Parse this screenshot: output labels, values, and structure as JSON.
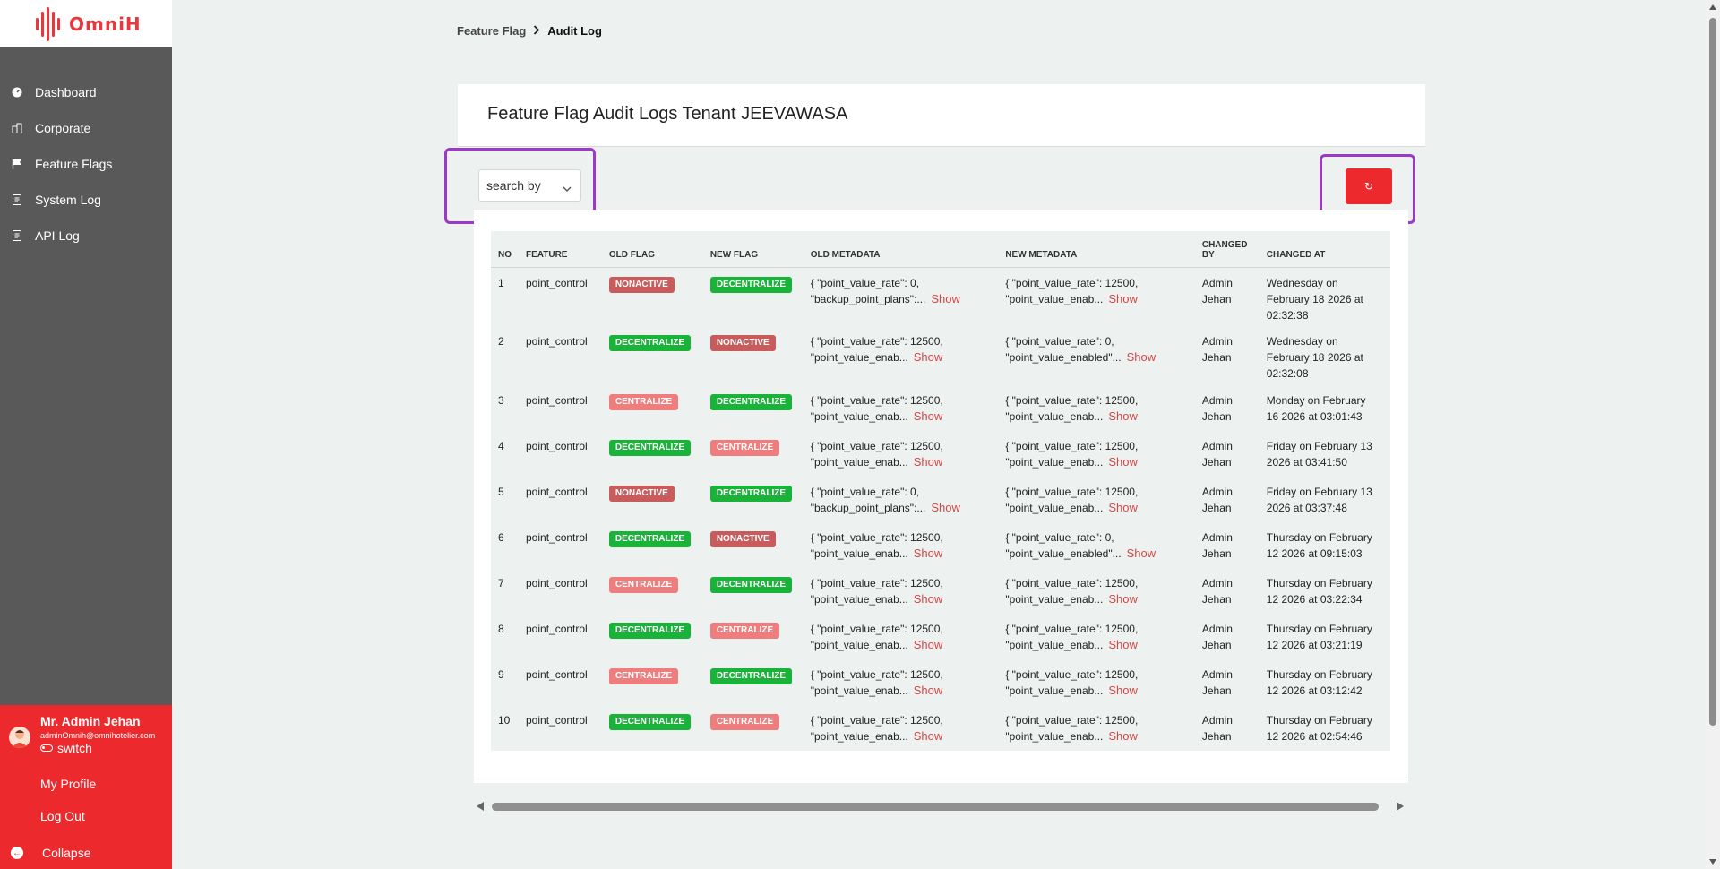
{
  "brand": {
    "name": "OmniH"
  },
  "sidebar": {
    "items": [
      {
        "label": "Dashboard",
        "icon": "dashboard-icon"
      },
      {
        "label": "Corporate",
        "icon": "building-icon"
      },
      {
        "label": "Feature Flags",
        "icon": "flag-icon"
      },
      {
        "label": "System Log",
        "icon": "document-icon"
      },
      {
        "label": "API Log",
        "icon": "document-icon"
      }
    ]
  },
  "user": {
    "name": "Mr. Admin Jehan",
    "email": "adminOmnih@omnihotelier.com",
    "switch_label": "switch",
    "profile_label": "My Profile",
    "logout_label": "Log Out",
    "collapse_label": "Collapse"
  },
  "breadcrumb": {
    "parent": "Feature Flag",
    "current": "Audit Log"
  },
  "page": {
    "title": "Feature Flag Audit Logs Tenant JEEVAWASA"
  },
  "search": {
    "label": "search by"
  },
  "refresh": {
    "icon": "refresh-icon",
    "glyph": "↻"
  },
  "table": {
    "headers": {
      "no": "NO",
      "feature": "FEATURE",
      "old_flag": "OLD FLAG",
      "new_flag": "NEW FLAG",
      "old_metadata": "OLD METADATA",
      "new_metadata": "NEW METADATA",
      "changed_by_1": "CHANGED",
      "changed_by_2": "BY",
      "changed_at": "CHANGED AT"
    },
    "show_label": "Show",
    "rows": [
      {
        "no": "1",
        "feature": "point_control",
        "old_flag": "NONACTIVE",
        "new_flag": "DECENTRALIZE",
        "old_meta_1": "{ \"point_value_rate\": 0,",
        "old_meta_2": "\"backup_point_plans\":...",
        "new_meta_1": "{ \"point_value_rate\": 12500,",
        "new_meta_2": "\"point_value_enab...",
        "by_1": "Admin",
        "by_2": "Jehan",
        "at_1": "Wednesday on",
        "at_2": "February 18 2026 at",
        "at_3": "02:32:38"
      },
      {
        "no": "2",
        "feature": "point_control",
        "old_flag": "DECENTRALIZE",
        "new_flag": "NONACTIVE",
        "old_meta_1": "{ \"point_value_rate\": 12500,",
        "old_meta_2": "\"point_value_enab...",
        "new_meta_1": "{ \"point_value_rate\": 0,",
        "new_meta_2": "\"point_value_enabled\"...",
        "by_1": "Admin",
        "by_2": "Jehan",
        "at_1": "Wednesday on",
        "at_2": "February 18 2026 at",
        "at_3": "02:32:08"
      },
      {
        "no": "3",
        "feature": "point_control",
        "old_flag": "CENTRALIZE",
        "new_flag": "DECENTRALIZE",
        "old_meta_1": "{ \"point_value_rate\": 12500,",
        "old_meta_2": "\"point_value_enab...",
        "new_meta_1": "{ \"point_value_rate\": 12500,",
        "new_meta_2": "\"point_value_enab...",
        "by_1": "Admin",
        "by_2": "Jehan",
        "at_1": "Monday on February",
        "at_2": "16 2026 at 03:01:43",
        "at_3": ""
      },
      {
        "no": "4",
        "feature": "point_control",
        "old_flag": "DECENTRALIZE",
        "new_flag": "CENTRALIZE",
        "old_meta_1": "{ \"point_value_rate\": 12500,",
        "old_meta_2": "\"point_value_enab...",
        "new_meta_1": "{ \"point_value_rate\": 12500,",
        "new_meta_2": "\"point_value_enab...",
        "by_1": "Admin",
        "by_2": "Jehan",
        "at_1": "Friday on February 13",
        "at_2": "2026 at 03:41:50",
        "at_3": ""
      },
      {
        "no": "5",
        "feature": "point_control",
        "old_flag": "NONACTIVE",
        "new_flag": "DECENTRALIZE",
        "old_meta_1": "{ \"point_value_rate\": 0,",
        "old_meta_2": "\"backup_point_plans\":...",
        "new_meta_1": "{ \"point_value_rate\": 12500,",
        "new_meta_2": "\"point_value_enab...",
        "by_1": "Admin",
        "by_2": "Jehan",
        "at_1": "Friday on February 13",
        "at_2": "2026 at 03:37:48",
        "at_3": ""
      },
      {
        "no": "6",
        "feature": "point_control",
        "old_flag": "DECENTRALIZE",
        "new_flag": "NONACTIVE",
        "old_meta_1": "{ \"point_value_rate\": 12500,",
        "old_meta_2": "\"point_value_enab...",
        "new_meta_1": "{ \"point_value_rate\": 0,",
        "new_meta_2": "\"point_value_enabled\"...",
        "by_1": "Admin",
        "by_2": "Jehan",
        "at_1": "Thursday on February",
        "at_2": "12 2026 at 09:15:03",
        "at_3": ""
      },
      {
        "no": "7",
        "feature": "point_control",
        "old_flag": "CENTRALIZE",
        "new_flag": "DECENTRALIZE",
        "old_meta_1": "{ \"point_value_rate\": 12500,",
        "old_meta_2": "\"point_value_enab...",
        "new_meta_1": "{ \"point_value_rate\": 12500,",
        "new_meta_2": "\"point_value_enab...",
        "by_1": "Admin",
        "by_2": "Jehan",
        "at_1": "Thursday on February",
        "at_2": "12 2026 at 03:22:34",
        "at_3": ""
      },
      {
        "no": "8",
        "feature": "point_control",
        "old_flag": "DECENTRALIZE",
        "new_flag": "CENTRALIZE",
        "old_meta_1": "{ \"point_value_rate\": 12500,",
        "old_meta_2": "\"point_value_enab...",
        "new_meta_1": "{ \"point_value_rate\": 12500,",
        "new_meta_2": "\"point_value_enab...",
        "by_1": "Admin",
        "by_2": "Jehan",
        "at_1": "Thursday on February",
        "at_2": "12 2026 at 03:21:19",
        "at_3": ""
      },
      {
        "no": "9",
        "feature": "point_control",
        "old_flag": "CENTRALIZE",
        "new_flag": "DECENTRALIZE",
        "old_meta_1": "{ \"point_value_rate\": 12500,",
        "old_meta_2": "\"point_value_enab...",
        "new_meta_1": "{ \"point_value_rate\": 12500,",
        "new_meta_2": "\"point_value_enab...",
        "by_1": "Admin",
        "by_2": "Jehan",
        "at_1": "Thursday on February",
        "at_2": "12 2026 at 03:12:42",
        "at_3": ""
      },
      {
        "no": "10",
        "feature": "point_control",
        "old_flag": "DECENTRALIZE",
        "new_flag": "CENTRALIZE",
        "old_meta_1": "{ \"point_value_rate\": 12500,",
        "old_meta_2": "\"point_value_enab...",
        "new_meta_1": "{ \"point_value_rate\": 12500,",
        "new_meta_2": "\"point_value_enab...",
        "by_1": "Admin",
        "by_2": "Jehan",
        "at_1": "Thursday on February",
        "at_2": "12 2026 at 02:54:46",
        "at_3": ""
      }
    ]
  },
  "colors": {
    "accent": "#ec2a2e",
    "sidebar": "#595959",
    "highlight": "#9d39c8",
    "nonactive": "#c85c5c",
    "decentralize": "#1ab33a",
    "centralize": "#ef7d7d"
  }
}
